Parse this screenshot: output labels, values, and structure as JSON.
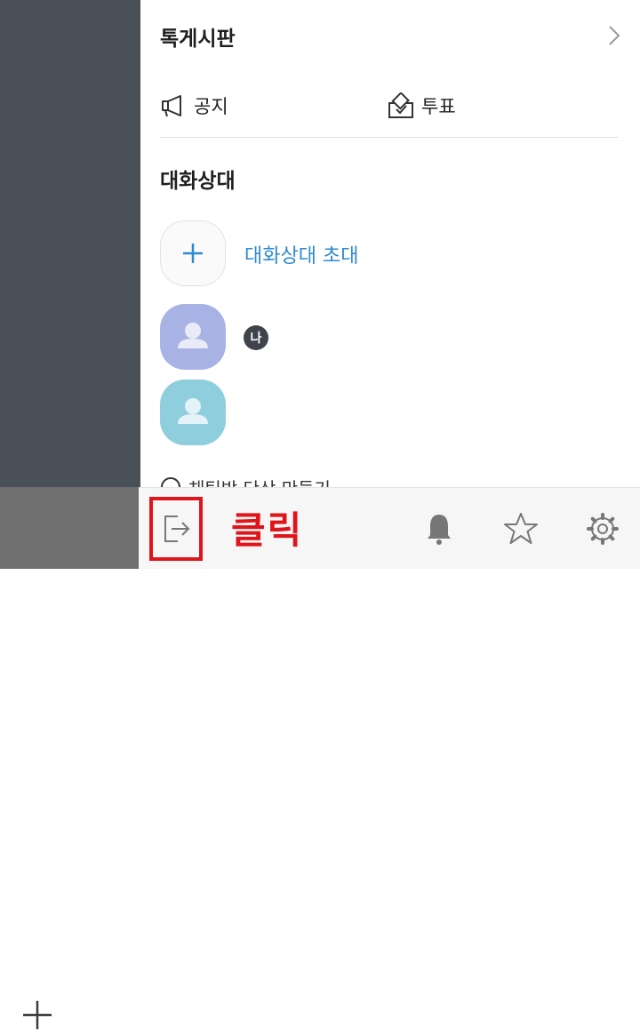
{
  "drawer": {
    "board_title": "톡게시판",
    "notice_label": "공지",
    "vote_label": "투표",
    "members_title": "대화상대",
    "invite_label": "대화상대 초대",
    "me_badge": "나",
    "partial_row_label": "채팅방 단상 만들기"
  },
  "bottombar": {
    "callout_text": "클릭"
  },
  "icons": [
    "plus-icon",
    "megaphone-icon",
    "vote-box-icon",
    "chevron-right-icon",
    "person-icon",
    "exit-icon",
    "bell-icon",
    "star-icon",
    "gear-icon"
  ],
  "colors": {
    "accent": "#2d8ad0",
    "highlight": "#e0151b",
    "dim_overlay": "#4a5058"
  }
}
